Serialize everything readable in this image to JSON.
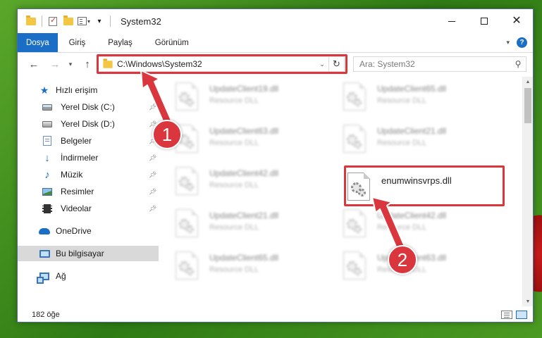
{
  "window": {
    "title": "System32"
  },
  "ribbon": {
    "tabs": [
      {
        "label": "Dosya",
        "active": true
      },
      {
        "label": "Giriş"
      },
      {
        "label": "Paylaş"
      },
      {
        "label": "Görünüm"
      }
    ]
  },
  "address": {
    "path": "C:\\Windows\\System32"
  },
  "search": {
    "placeholder": "Ara: System32"
  },
  "sidebar": {
    "quick_access": "Hızlı erişim",
    "items": [
      {
        "label": "Yerel Disk (C:)",
        "icon": "drive-c-icon",
        "pinned": true
      },
      {
        "label": "Yerel Disk (D:)",
        "icon": "drive-d-icon",
        "pinned": true
      },
      {
        "label": "Belgeler",
        "icon": "documents-icon",
        "pinned": true
      },
      {
        "label": "İndirmeler",
        "icon": "downloads-icon",
        "pinned": true
      },
      {
        "label": "Müzik",
        "icon": "music-icon",
        "pinned": true
      },
      {
        "label": "Resimler",
        "icon": "pictures-icon",
        "pinned": true
      },
      {
        "label": "Videolar",
        "icon": "videos-icon",
        "pinned": true
      }
    ],
    "onedrive": "OneDrive",
    "this_pc": "Bu bilgisayar",
    "network": "Ağ"
  },
  "files": [
    {
      "name": "UpdateClient19.dll",
      "type": "Resource DLL",
      "blurred": true
    },
    {
      "name": "UpdateClient65.dll",
      "type": "Resource DLL",
      "blurred": true
    },
    {
      "name": "UpdateClient63.dll",
      "type": "Resource DLL",
      "blurred": true
    },
    {
      "name": "UpdateClient21.dll",
      "type": "Resource DLL",
      "blurred": true
    },
    {
      "name": "UpdateClient42.dll",
      "type": "Resource DLL",
      "blurred": true
    },
    {
      "name": "enumwinsvrps.dll",
      "type": "",
      "blurred": false
    },
    {
      "name": "UpdateClient21.dll",
      "type": "Resource DLL",
      "blurred": true
    },
    {
      "name": "UpdateClient42.dll",
      "type": "Resource DLL",
      "blurred": true
    },
    {
      "name": "UpdateClient65.dll",
      "type": "Resource DLL",
      "blurred": true
    },
    {
      "name": "UpdateClient63.dll",
      "type": "Resource DLL",
      "blurred": true
    }
  ],
  "status": {
    "count": "182 öğe"
  },
  "callouts": {
    "one": "1",
    "two": "2"
  },
  "colors": {
    "accent": "#1a6ec5",
    "highlight": "#d9363e"
  }
}
